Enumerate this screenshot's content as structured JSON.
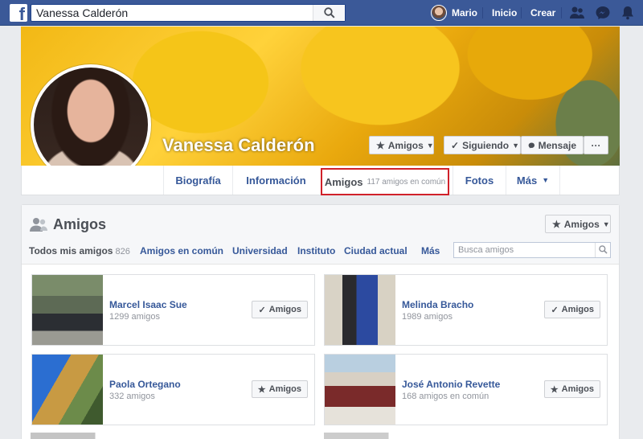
{
  "topbar": {
    "logo": "f",
    "search_value": "Vanessa Calderón",
    "user_name": "Mario",
    "home": "Inicio",
    "create": "Crear",
    "icons": [
      "friend-requests-icon",
      "messenger-icon",
      "notifications-icon"
    ],
    "brand_color": "#3b5998"
  },
  "profile": {
    "name": "Vanessa Calderón",
    "buttons": {
      "friends": "Amigos",
      "following": "Siguiendo",
      "message": "Mensaje",
      "more": "···"
    }
  },
  "tabs": [
    {
      "label": "Biografía"
    },
    {
      "label": "Información"
    },
    {
      "label": "Amigos",
      "count": "117 amigos en común",
      "active": true
    },
    {
      "label": "Fotos"
    },
    {
      "label": "Más"
    }
  ],
  "friends_panel": {
    "title": "Amigos",
    "header_button": "Amigos",
    "filters": [
      {
        "label": "Todos mis amigos",
        "count": "826"
      },
      {
        "label": "Amigos en común"
      },
      {
        "label": "Universidad"
      },
      {
        "label": "Instituto"
      },
      {
        "label": "Ciudad actual"
      },
      {
        "label": "Más"
      }
    ],
    "search_placeholder": "Busca amigos",
    "friends": [
      {
        "name": "Marcel Isaac Sue",
        "sub": "1299 amigos",
        "button": "Amigos",
        "button_icon": "check-icon"
      },
      {
        "name": "Melinda Bracho",
        "sub": "1989 amigos",
        "button": "Amigos",
        "button_icon": "check-icon"
      },
      {
        "name": "Paola Ortegano",
        "sub": "332 amigos",
        "button": "Amigos",
        "button_icon": "star-icon"
      },
      {
        "name": "José Antonio Revette",
        "sub": "168 amigos en común",
        "button": "Amigos",
        "button_icon": "star-icon"
      }
    ]
  },
  "highlight_color": "#d0212a"
}
